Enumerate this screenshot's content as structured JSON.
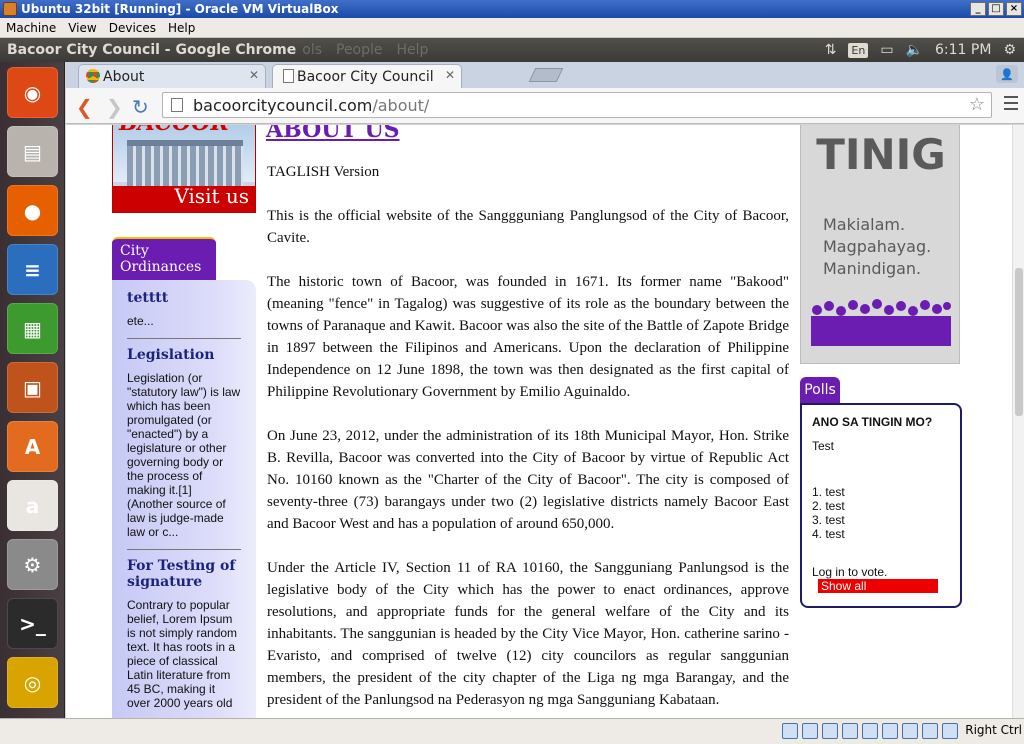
{
  "vbox": {
    "title": "Ubuntu 32bit [Running] - Oracle VM VirtualBox",
    "menu": [
      "Machine",
      "View",
      "Devices",
      "Help"
    ],
    "host_key": "Right Ctrl"
  },
  "panel": {
    "window_title": "Bacoor City Council - Google Chrome",
    "ghost_menu": [
      "ols",
      "People",
      "Help"
    ],
    "keyboard": "En",
    "clock": "6:11 PM"
  },
  "launcher": [
    {
      "name": "ubuntu-dash",
      "glyph": "◉",
      "color": "#dd4814"
    },
    {
      "name": "files",
      "glyph": "▤",
      "color": "#b8b4ad"
    },
    {
      "name": "firefox",
      "glyph": "●",
      "color": "#e66000"
    },
    {
      "name": "writer",
      "glyph": "≡",
      "color": "#2a6ebd"
    },
    {
      "name": "calc",
      "glyph": "▦",
      "color": "#3c9a2f"
    },
    {
      "name": "impress",
      "glyph": "▣",
      "color": "#c0531b"
    },
    {
      "name": "software-center",
      "glyph": "A",
      "color": "#e26b1f"
    },
    {
      "name": "amazon",
      "glyph": "a",
      "color": "#e9e6e1"
    },
    {
      "name": "settings",
      "glyph": "⚙",
      "color": "#8a8a8a"
    },
    {
      "name": "terminal",
      "glyph": ">_",
      "color": "#2b2b2b"
    },
    {
      "name": "chrome",
      "glyph": "◎",
      "color": "#d9a300"
    }
  ],
  "browser": {
    "tabs": [
      {
        "label": "About",
        "active": false
      },
      {
        "label": "Bacoor City Council",
        "active": true
      }
    ],
    "url_host": "bacoorcitycouncil.com",
    "url_path": "/about/"
  },
  "page": {
    "heading_partial": "ABOUT US",
    "banner_brand": "BACOOR",
    "banner_visit": "Visit us",
    "ordinances_tab": "City Ordinances",
    "ordinances": [
      {
        "title": "tetttt",
        "body": "ete..."
      },
      {
        "title": "Legislation",
        "body": "Legislation (or \"statutory law\") is law which has been promulgated (or \"enacted\") by a legislature or other governing body or the process of making it.[1] (Another source of law is judge-made law or c..."
      },
      {
        "title": "For Testing of signature",
        "body": "Contrary to popular belief, Lorem Ipsum is not simply random text. It has roots in a piece of classical Latin literature from 45 BC, making it over 2000 years old"
      }
    ],
    "paragraphs": [
      "TAGLISH Version",
      "This is the official website of the Sanggguniang Panglungsod of the City of Bacoor, Cavite.",
      "The historic town of Bacoor, was founded in 1671. Its former name \"Bakood\" (meaning \"fence\" in Tagalog) was suggestive of its role as the boundary between the towns of Paranaque and Kawit. Bacoor was also the site of the Battle of Zapote Bridge in 1897 between the Filipinos and Americans. Upon the declaration of Philippine Independence on 12 June 1898, the town was then designated as the first capital of Philippine Revolutionary Government by Emilio Aguinaldo.",
      "On June 23, 2012, under the administration of its 18th Municipal Mayor, Hon. Strike B. Revilla, Bacoor was converted into the City of Bacoor by virtue of Republic Act No. 10160 known as the \"Charter of the City of Bacoor\". The city is composed of seventy-three (73) barangays under two (2) legislative districts namely Bacoor East and Bacoor West and has a population of around 650,000.",
      "Under the Article IV, Section 11 of RA 10160, the Sangguniang Panlungsod is the legislative body of the City which has the power to enact ordinances, approve resolutions, and appropriate funds for the general welfare of the City and its inhabitants. The sanggunian is headed by the City Vice Mayor, Hon. catherine sarino - Evaristo, and comprised of twelve (12) city councilors as regular sanggunian members, the president of the city chapter of the Liga ng mga Barangay, and the president of the Panlungsod na Pederasyon ng mga Sangguniang Kabataan."
    ],
    "tinig": {
      "title": "TINIG",
      "lines": [
        "Makialam.",
        "Magpahayag.",
        "Manindigan."
      ]
    },
    "polls": {
      "tab": "Polls",
      "question": "ANO SA TINGIN MO?",
      "subtitle": "Test",
      "options": [
        "1. test",
        "2. test",
        "3. test",
        "4. test"
      ],
      "login_text": "Log in to vote.",
      "show_all": "Show all"
    }
  },
  "colors": {
    "accent": "#6a1db0",
    "banner_red": "#cc0000"
  }
}
